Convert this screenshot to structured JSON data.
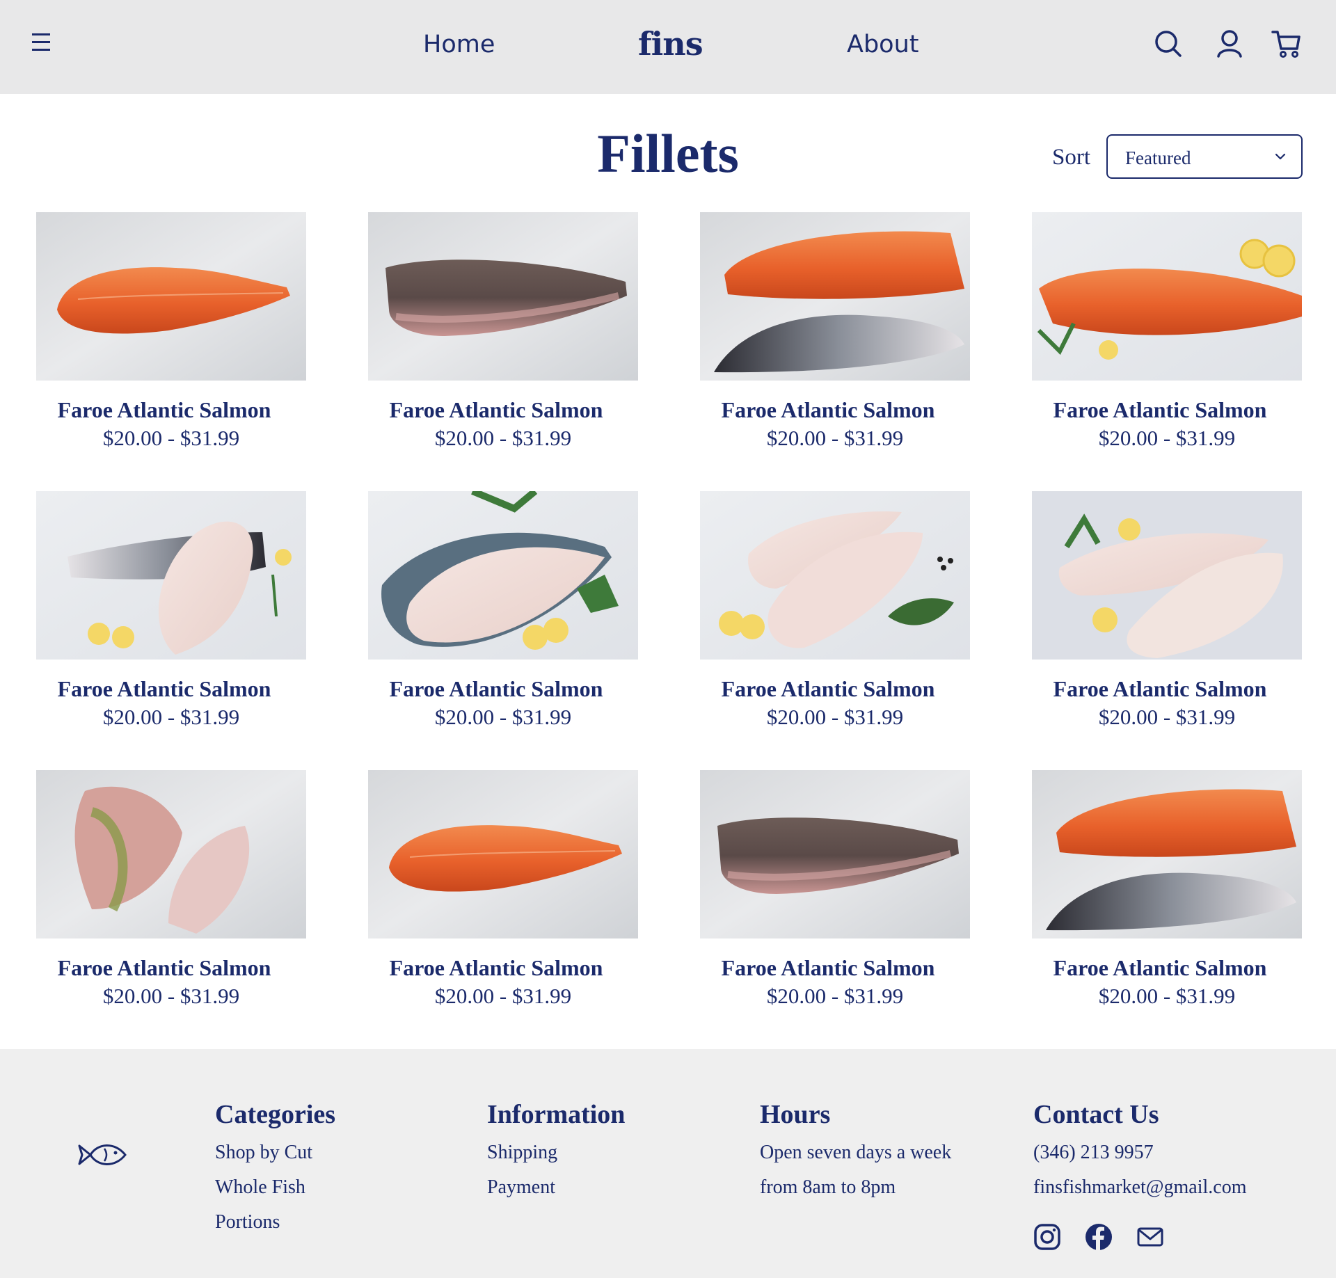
{
  "header": {
    "nav_home": "Home",
    "brand": "fins",
    "nav_about": "About",
    "icons": [
      "menu-icon",
      "search-icon",
      "user-icon",
      "cart-icon"
    ]
  },
  "page": {
    "title": "Fillets",
    "sort_label": "Sort",
    "sort_value": "Featured"
  },
  "products": [
    {
      "name": "Faroe Atlantic Salmon",
      "price": "$20.00 - $31.99",
      "image": "salmon-fillet-on-ice"
    },
    {
      "name": "Faroe Atlantic Salmon",
      "price": "$20.00 - $31.99",
      "image": "dark-skin-fillet-on-ice"
    },
    {
      "name": "Faroe Atlantic Salmon",
      "price": "$20.00 - $31.99",
      "image": "salmon-two-sides-on-ice"
    },
    {
      "name": "Faroe Atlantic Salmon",
      "price": "$20.00 - $31.99",
      "image": "salmon-with-lemon-dill"
    },
    {
      "name": "Faroe Atlantic Salmon",
      "price": "$20.00 - $31.99",
      "image": "white-fillet-with-lemon-dill"
    },
    {
      "name": "Faroe Atlantic Salmon",
      "price": "$20.00 - $31.99",
      "image": "trout-fillet-with-parsley"
    },
    {
      "name": "Faroe Atlantic Salmon",
      "price": "$20.00 - $31.99",
      "image": "pink-fillets-with-bay-leaf"
    },
    {
      "name": "Faroe Atlantic Salmon",
      "price": "$20.00 - $31.99",
      "image": "white-fillets-with-lemon"
    },
    {
      "name": "Faroe Atlantic Salmon",
      "price": "$20.00 - $31.99",
      "image": "snapper-fillets-on-ice"
    },
    {
      "name": "Faroe Atlantic Salmon",
      "price": "$20.00 - $31.99",
      "image": "salmon-fillet-on-ice"
    },
    {
      "name": "Faroe Atlantic Salmon",
      "price": "$20.00 - $31.99",
      "image": "dark-skin-fillet-on-ice"
    },
    {
      "name": "Faroe Atlantic Salmon",
      "price": "$20.00 - $31.99",
      "image": "salmon-two-sides-on-ice"
    }
  ],
  "footer": {
    "logo": "fish-logo-icon",
    "categories": {
      "title": "Categories",
      "items": [
        "Shop by Cut",
        "Whole Fish",
        "Portions"
      ]
    },
    "information": {
      "title": "Information",
      "items": [
        "Shipping",
        "Payment"
      ]
    },
    "hours": {
      "title": "Hours",
      "items": [
        "Open seven days a week",
        "from 8am to 8pm"
      ]
    },
    "contact": {
      "title": "Contact Us",
      "items": [
        "(346) 213 9957",
        "finsfishmarket@gmail.com"
      ]
    },
    "social_icons": [
      "instagram-icon",
      "facebook-icon",
      "mail-icon"
    ]
  },
  "colors": {
    "brand_navy": "#1b2a6b",
    "header_bg": "#e8e8e9",
    "footer_bg": "#efefef"
  }
}
